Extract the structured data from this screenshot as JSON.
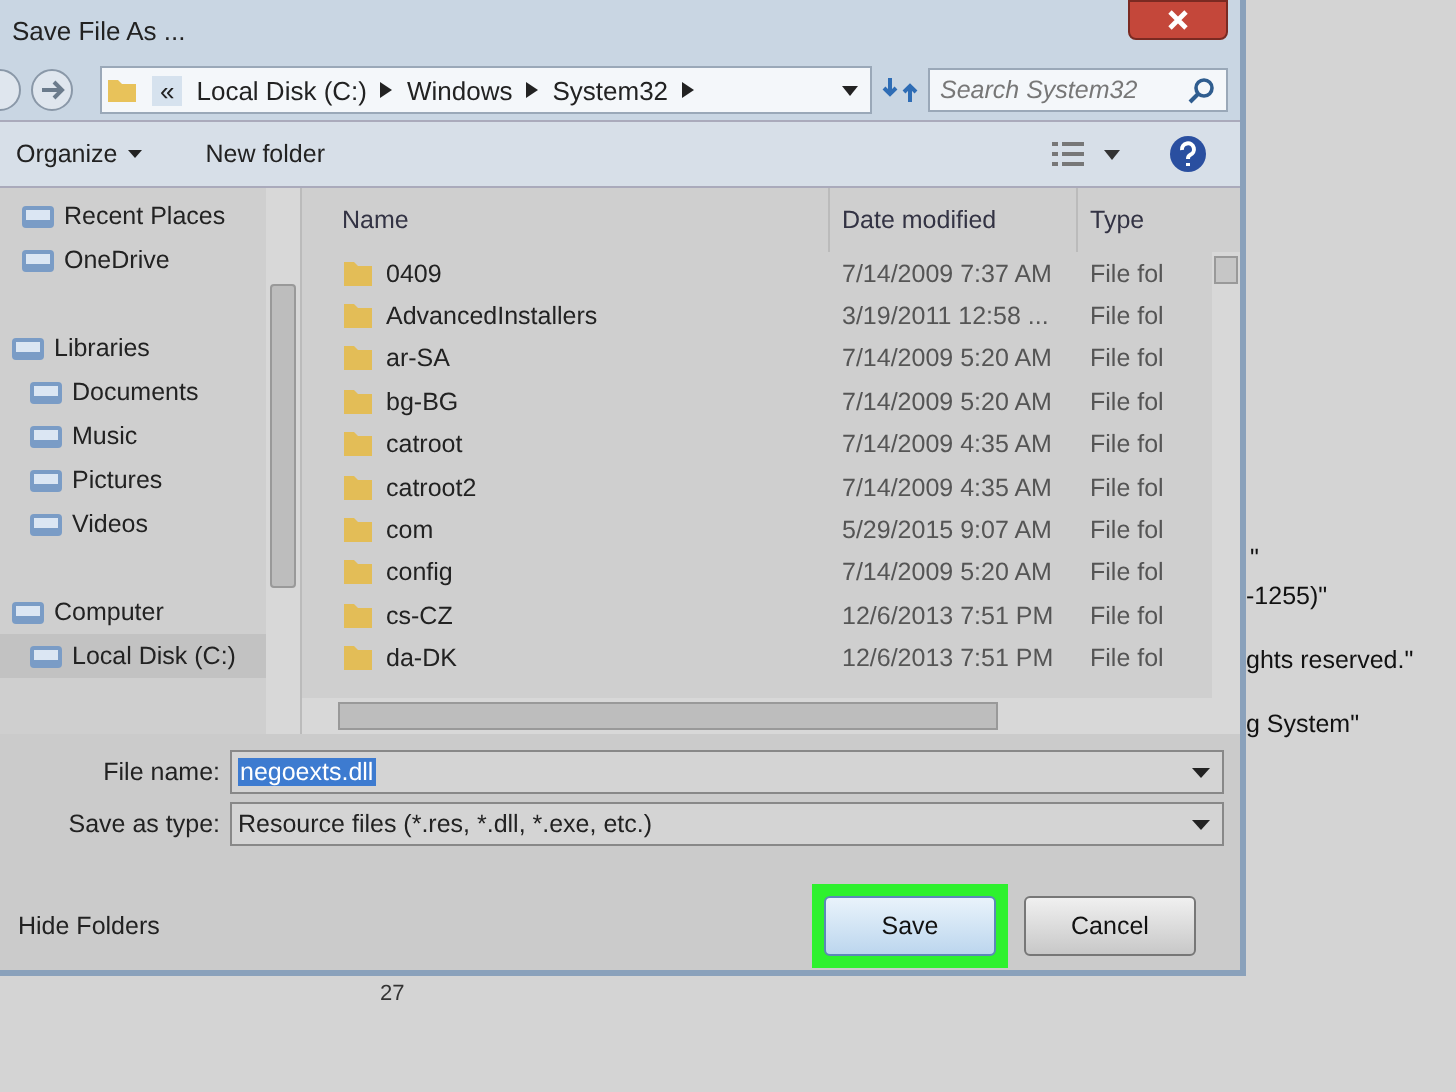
{
  "window": {
    "title": "Save File As ..."
  },
  "address_bar": {
    "overflow": "«",
    "crumbs": [
      "Local Disk (C:)",
      "Windows",
      "System32"
    ]
  },
  "search": {
    "placeholder": "Search System32"
  },
  "toolbar": {
    "organize": "Organize",
    "new_folder": "New folder"
  },
  "sidebar": {
    "items": [
      {
        "label": "Recent Places",
        "selected": false
      },
      {
        "label": "OneDrive",
        "selected": false
      },
      {
        "label": "Libraries",
        "selected": false,
        "children": [
          {
            "label": "Documents",
            "selected": false
          },
          {
            "label": "Music",
            "selected": false
          },
          {
            "label": "Pictures",
            "selected": false
          },
          {
            "label": "Videos",
            "selected": false
          }
        ]
      },
      {
        "label": "Computer",
        "selected": false,
        "children": [
          {
            "label": "Local Disk (C:)",
            "selected": true
          }
        ]
      }
    ]
  },
  "table": {
    "columns": [
      "Name",
      "Date modified",
      "Type"
    ],
    "rows": [
      [
        "0409",
        "7/14/2009 7:37 AM",
        "File fol"
      ],
      [
        "AdvancedInstallers",
        "3/19/2011 12:58 ...",
        "File fol"
      ],
      [
        "ar-SA",
        "7/14/2009 5:20 AM",
        "File fol"
      ],
      [
        "bg-BG",
        "7/14/2009 5:20 AM",
        "File fol"
      ],
      [
        "catroot",
        "7/14/2009 4:35 AM",
        "File fol"
      ],
      [
        "catroot2",
        "7/14/2009 4:35 AM",
        "File fol"
      ],
      [
        "com",
        "5/29/2015 9:07 AM",
        "File fol"
      ],
      [
        "config",
        "7/14/2009 5:20 AM",
        "File fol"
      ],
      [
        "cs-CZ",
        "12/6/2013 7:51 PM",
        "File fol"
      ],
      [
        "da-DK",
        "12/6/2013 7:51 PM",
        "File fol"
      ]
    ]
  },
  "form": {
    "file_name_label": "File name:",
    "file_name": "negoexts.dll",
    "type_label": "Save as type:",
    "type_value": "Resource files (*.res, *.dll, *.exe, etc.)"
  },
  "hide_folders": "Hide Folders",
  "buttons": [
    {
      "label": "Save",
      "highlighted": true
    },
    {
      "label": "Cancel",
      "highlighted": false
    }
  ],
  "background_text": [
    "\"",
    "-1255)\"",
    "ghts reserved.\"",
    "g System\""
  ],
  "background_line_number": "27"
}
